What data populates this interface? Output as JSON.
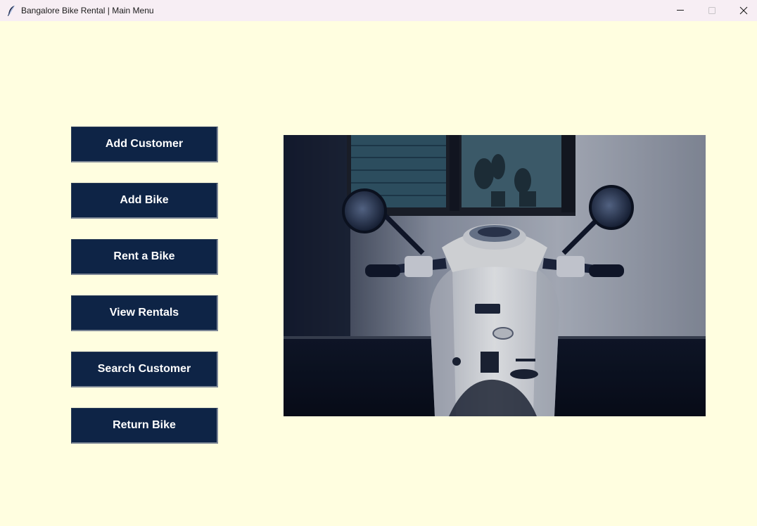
{
  "window": {
    "title": "Bangalore Bike Rental | Main Menu",
    "icon": "feather-icon",
    "background": "#fffee0"
  },
  "menu": {
    "accent": "#0e2446",
    "buttons": [
      {
        "label": "Add Customer"
      },
      {
        "label": "Add Bike"
      },
      {
        "label": "Rent a Bike"
      },
      {
        "label": "View Rentals"
      },
      {
        "label": "Search Customer"
      },
      {
        "label": "Return Bike"
      }
    ]
  },
  "image": {
    "subject": "scooter-photo"
  }
}
